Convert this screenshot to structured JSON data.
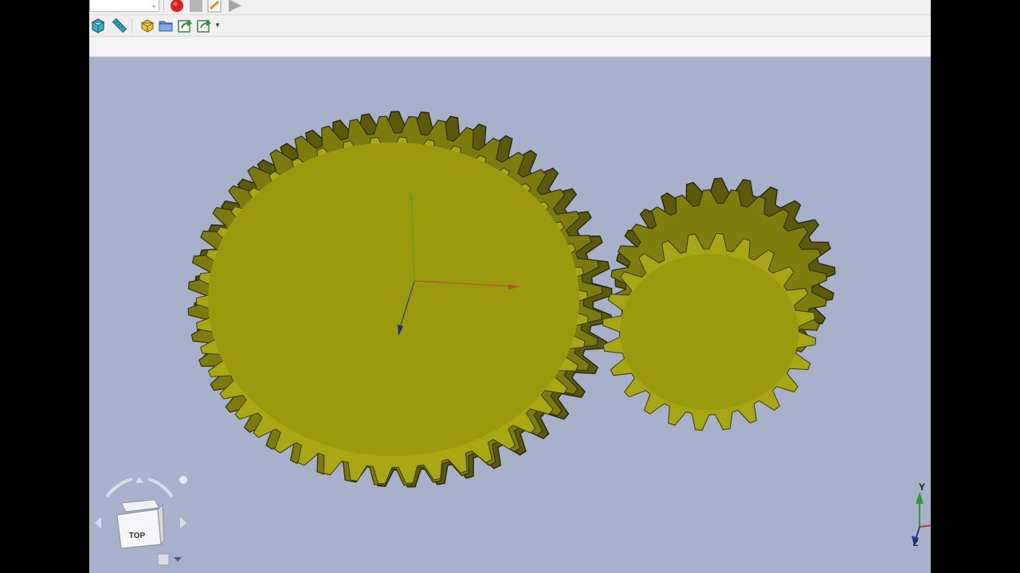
{
  "toolbar": {
    "workbench_combo_value": "",
    "macro_record_icon": "record-icon",
    "macro_stop_icon": "stop-icon",
    "macro_edit_icon": "edit-macro-icon",
    "macro_run_icon": "play-icon",
    "view_icons": [
      "std-view-box-icon",
      "measure-icon",
      "part-icon",
      "group-icon",
      "link-icon",
      "link-sub-icon"
    ]
  },
  "viewport": {
    "navcube_face_label": "TOP",
    "axis_y_label": "Y",
    "axis_z_label": "Z",
    "gear_color": "#9b9a0e",
    "background_color": "#a8b1cc"
  }
}
